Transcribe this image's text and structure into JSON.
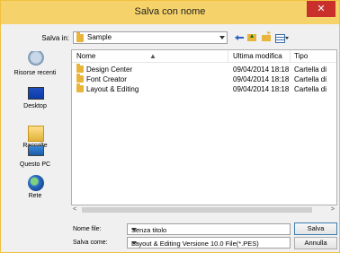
{
  "window": {
    "title": "Salva con nome",
    "close_glyph": "✕"
  },
  "savein": {
    "label": "Salva in:",
    "value": "Sample"
  },
  "toolbar": {
    "icons": [
      "back-icon",
      "up-folder-icon",
      "new-folder-icon",
      "view-menu-icon"
    ]
  },
  "places": [
    {
      "label": "Risorse recenti",
      "icon": "recent-icon"
    },
    {
      "label": "Desktop",
      "icon": "desktop-icon"
    },
    {
      "label": "Raccolte",
      "icon": "libraries-icon"
    },
    {
      "label": "Questo PC",
      "icon": "computer-icon"
    },
    {
      "label": "Rete",
      "icon": "network-icon"
    }
  ],
  "columns": {
    "name": "Nome",
    "date": "Ultima modifica",
    "type": "Tipo"
  },
  "rows": [
    {
      "name": "Design Center",
      "date": "09/04/2014 18:18",
      "type": "Cartella di"
    },
    {
      "name": "Font Creator",
      "date": "09/04/2014 18:18",
      "type": "Cartella di"
    },
    {
      "name": "Layout & Editing",
      "date": "09/04/2014 18:18",
      "type": "Cartella di"
    }
  ],
  "filename": {
    "label": "Nome file:",
    "value": "Senza titolo"
  },
  "filetype": {
    "label": "Salva come:",
    "value": "Layout & Editing Versione 10.0 File(*.PES)"
  },
  "buttons": {
    "save": "Salva",
    "cancel": "Annulla"
  },
  "colors": {
    "titlebar": "#f6d36a",
    "close": "#c9302c",
    "folder": "#e8b53a"
  }
}
